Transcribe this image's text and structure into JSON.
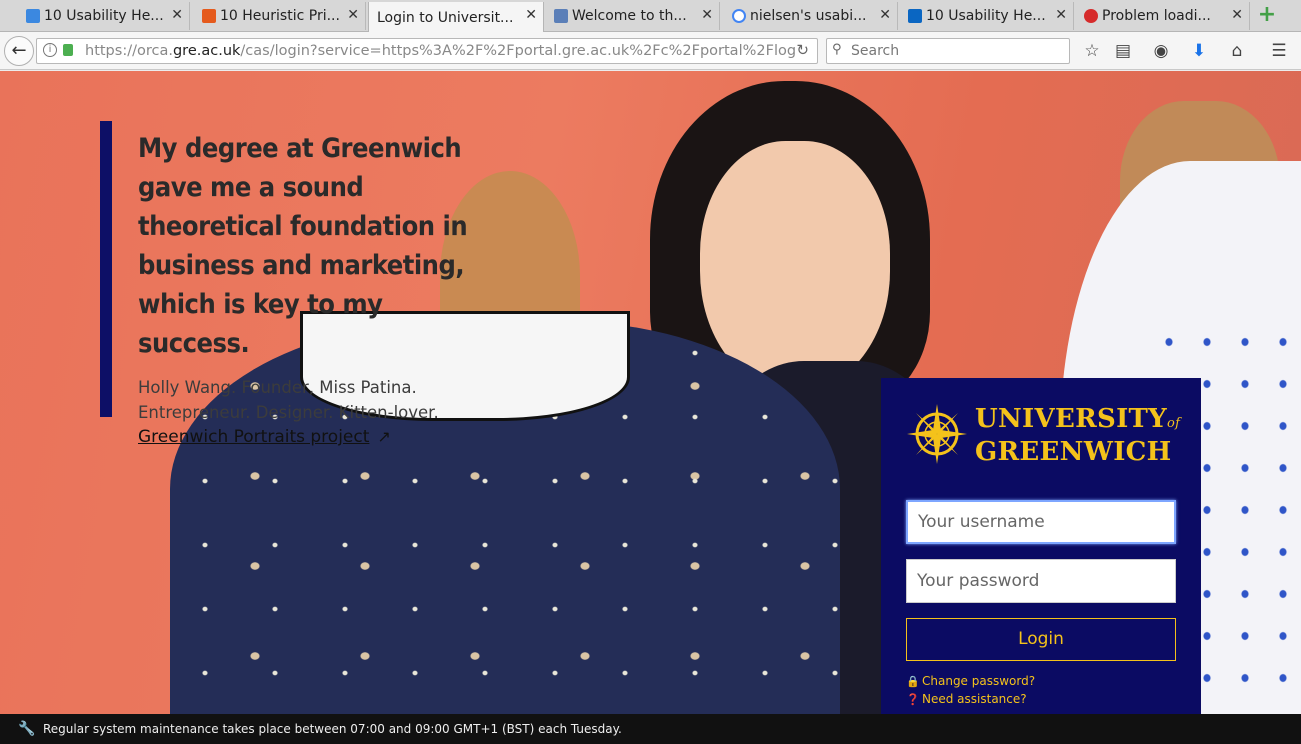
{
  "browser": {
    "tabs": [
      {
        "title": "10 Usability He...",
        "favicon_color": "#3b88e0",
        "active": false
      },
      {
        "title": "10 Heuristic Pri...",
        "favicon_color": "#e55a1c",
        "active": false
      },
      {
        "title": "Login to Universit...",
        "favicon_color": "",
        "active": true
      },
      {
        "title": "Welcome to th...",
        "favicon_color": "#5b7fb8",
        "active": false
      },
      {
        "title": "nielsen's usabi...",
        "favicon_color": "#4285f4",
        "active": false
      },
      {
        "title": "10 Usability He...",
        "favicon_color": "#0a66c2",
        "active": false
      },
      {
        "title": "Problem loadi...",
        "favicon_color": "#d62b2b",
        "active": false
      }
    ],
    "close_glyph": "✕",
    "new_tab_glyph": "+",
    "url_prefix": "https://orca.",
    "url_host": "gre.ac.uk",
    "url_rest": "/cas/login?service=https%3A%2F%2Fportal.gre.ac.uk%2Fc%2Fportal%2Flog",
    "search_placeholder": "Search"
  },
  "quote": {
    "text": "My degree at Greenwich gave me a sound theoretical foundation in business and marketing, which is key to my success.",
    "author_line1": "Holly Wang. Founder, Miss Patina.",
    "author_line2": "Entrepreneur. Designer. Kitten-lover.",
    "link_text": "Greenwich Portraits project",
    "accent_color": "#0d0f66"
  },
  "login": {
    "logo_line1": "UNIVERSITY",
    "logo_of": "of",
    "logo_line2": "GREENWICH",
    "username_placeholder": "Your username",
    "password_placeholder": "Your password",
    "login_label": "Login",
    "change_password": "Change password?",
    "need_assistance": "Need assistance?",
    "panel_color": "#0b0b63",
    "accent_color": "#f4c21b"
  },
  "status": {
    "message": "Regular system maintenance takes place between 07:00 and 09:00 GMT+1 (BST) each Tuesday."
  }
}
